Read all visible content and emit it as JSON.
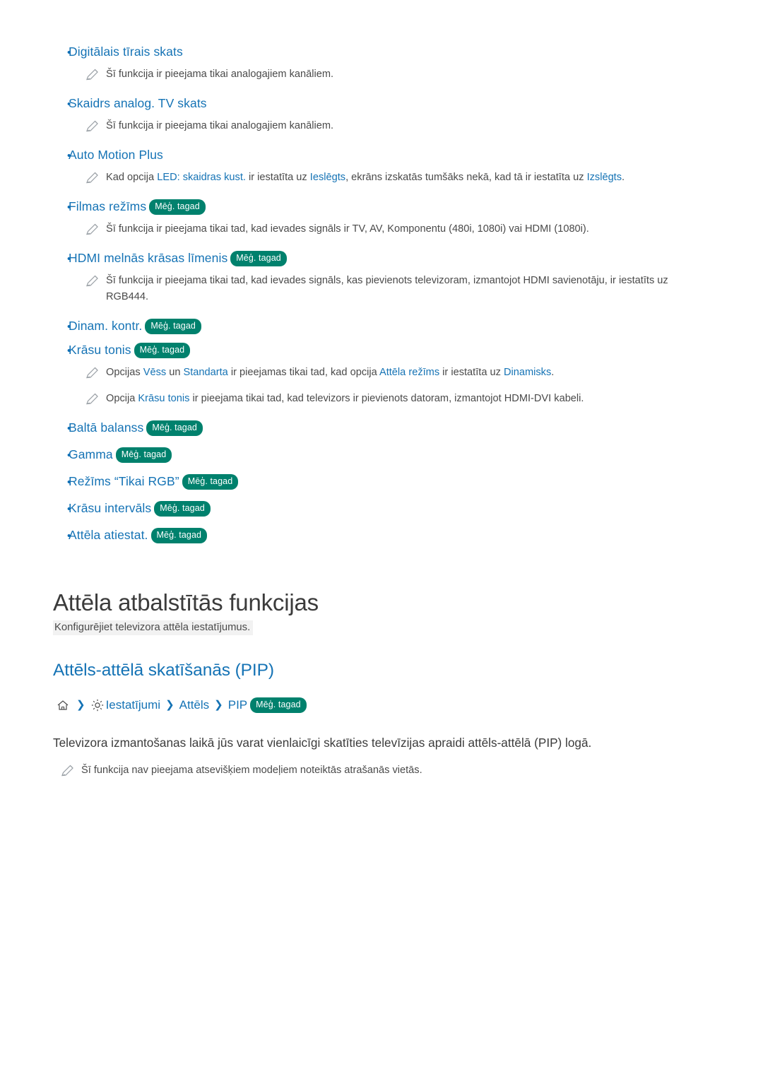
{
  "badge_label": "Mēģ. tagad",
  "items": [
    {
      "title": "Digitālais tīrais skats",
      "badge": false,
      "notes": [
        {
          "text": "Šī funkcija ir pieejama tikai analogajiem kanāliem."
        }
      ]
    },
    {
      "title": "Skaidrs analog. TV skats",
      "badge": false,
      "notes": [
        {
          "text": "Šī funkcija ir pieejama tikai analogajiem kanāliem."
        }
      ]
    },
    {
      "title": "Auto Motion Plus",
      "badge": false,
      "notes": [
        {
          "text": "Kad opcija LED: skaidras kust. ir iestatīta uz Ieslēgts, ekrāns izskatās tumšāks nekā, kad tā ir iestatīta uz Izslēgts."
        }
      ]
    },
    {
      "title": "Filmas režīms",
      "badge": true,
      "notes": [
        {
          "text": "Šī funkcija ir pieejama tikai tad, kad ievades signāls ir TV, AV, Komponentu (480i, 1080i) vai HDMI (1080i)."
        }
      ]
    },
    {
      "title": "HDMI melnās krāsas līmenis",
      "badge": true,
      "notes": [
        {
          "text": "Šī funkcija ir pieejama tikai tad, kad ievades signāls, kas pievienots televizoram, izmantojot HDMI savienotāju, ir iestatīts uz RGB444."
        }
      ]
    },
    {
      "title": "Dinam. kontr.",
      "badge": true,
      "notes": []
    },
    {
      "title": "Krāsu tonis",
      "badge": true,
      "notes": [
        {
          "text": "Opcijas Vēss un Standarta ir pieejamas tikai tad, kad opcija Attēla režīms ir iestatīta uz Dinamisks."
        },
        {
          "text": "Opcija Krāsu tonis ir pieejama tikai tad, kad televizors ir pievienots datoram, izmantojot HDMI-DVI kabeli."
        }
      ]
    },
    {
      "title": "Baltā balanss",
      "badge": true,
      "notes": []
    },
    {
      "title": "Gamma",
      "badge": true,
      "notes": []
    },
    {
      "title": "Režīms “Tikai RGB”",
      "badge": true,
      "notes": []
    },
    {
      "title": "Krāsu intervāls",
      "badge": true,
      "notes": []
    },
    {
      "title": "Attēla atiestat.",
      "badge": true,
      "notes": []
    }
  ],
  "notes_text": {
    "n0": "Šī funkcija ir pieejama tikai analogajiem kanāliem.",
    "n1": "Šī funkcija ir pieejama tikai analogajiem kanāliem.",
    "n2_a": "Kad opcija ",
    "n2_k1": "LED: skaidras kust.",
    "n2_b": " ir iestatīta uz ",
    "n2_k2": "Ieslēgts",
    "n2_c": ", ekrāns izskatās tumšāks nekā, kad tā ir iestatīta uz ",
    "n2_k3": "Izslēgts",
    "n2_d": ".",
    "n3": "Šī funkcija ir pieejama tikai tad, kad ievades signāls ir TV, AV, Komponentu (480i, 1080i) vai HDMI (1080i).",
    "n4": "Šī funkcija ir pieejama tikai tad, kad ievades signāls, kas pievienots televizoram, izmantojot HDMI savienotāju, ir iestatīts uz RGB444.",
    "n6_a": "Opcijas ",
    "n6_k1": "Vēss",
    "n6_b": " un ",
    "n6_k2": "Standarta",
    "n6_c": " ir pieejamas tikai tad, kad opcija ",
    "n6_k3": "Attēla režīms",
    "n6_d": " ir iestatīta uz ",
    "n6_k4": "Dinamisks",
    "n6_e": ".",
    "n7_a": "Opcija ",
    "n7_k1": "Krāsu tonis",
    "n7_b": " ir pieejama tikai tad, kad televizors ir pievienots datoram, izmantojot HDMI-DVI kabeli."
  },
  "section": {
    "title": "Attēla atbalstītās funkcijas",
    "subtitle": "Konfigurējiet televizora attēla iestatījumus.",
    "sub_title": "Attēls-attēlā skatīšanās (PIP)",
    "breadcrumb": {
      "home_icon": "home-icon",
      "gear_icon": "gear-icon",
      "item1": "Iestatījumi",
      "item2": "Attēls",
      "item3": "PIP"
    },
    "paragraph": "Televizora izmantošanas laikā jūs varat vienlaicīgi skatīties televīzijas apraidi attēls-attēlā (PIP) logā.",
    "footnote": "Šī funkcija nav pieejama atsevišķiem modeļiem noteiktās atrašanās vietās."
  }
}
